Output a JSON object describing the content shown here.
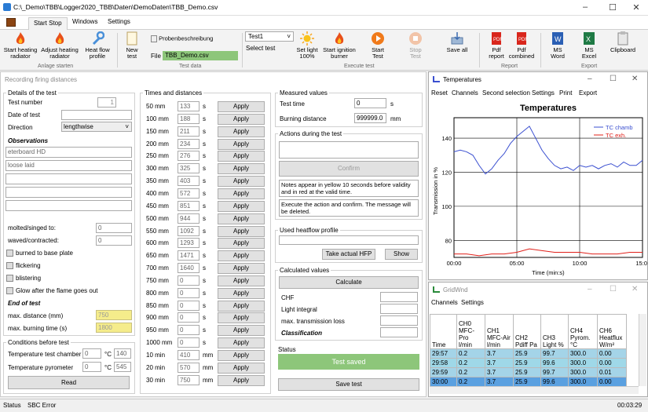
{
  "title": "C:\\_Demo\\TBB\\Logger2020_TBB\\Daten\\DemoDaten\\TBB_Demo.csv",
  "tabs": [
    "Start Stop",
    "Windows",
    "Settings"
  ],
  "ribbon": {
    "start_heating": "Start heating radiator",
    "adjust_heating": "Adjust heating radiator",
    "heat_flow": "Heat flow profile",
    "group_anlage": "Anlage starten",
    "new_test": "New test",
    "probenbeschreibung": "Probenbeschreibung",
    "file_label": "File",
    "file_value": "TBB_Demo.csv",
    "group_testdata": "Test data",
    "test_select": "Test1",
    "select_test": "Select test",
    "set_light": "Set light 100%",
    "start_ignition": "Start ignition burner",
    "start_test": "Start Test",
    "stop_test": "Stop Test",
    "save_all": "Save all",
    "group_execute": "Execute test",
    "pdf_report": "Pdf report",
    "pdf_combined": "Pdf combined",
    "group_report": "Report",
    "ms_word": "MS Word",
    "ms_excel": "MS Excel",
    "clipboard": "Clipboard",
    "group_export": "Export"
  },
  "main": {
    "header": "Recording firing distances",
    "details_title": "Details of the test",
    "test_number_label": "Test number",
    "test_number": "1",
    "date_label": "Date of test",
    "direction_label": "Direction",
    "direction": "lengthwise",
    "observations_label": "Observations",
    "obs": [
      "eterboard HD",
      "loose laid",
      "",
      "",
      "",
      ""
    ],
    "molted_label": "molted/singed to:",
    "molted": "0",
    "waved_label": "waved/contracted:",
    "waved": "0",
    "checks": [
      "burned to base plate",
      "flickering",
      "blistering",
      "Glow after the flame goes out"
    ],
    "end_label": "End of test",
    "max_dist_label": "max. distance (mm)",
    "max_dist": "750",
    "max_time_label": "max. burning time (s)",
    "max_time": "1800",
    "conditions_title": "Conditions before test",
    "temp_chamber_label": "Temperature test chamber",
    "temp_chamber_a": "0",
    "temp_chamber_b": "140",
    "temp_pyro_label": "Temperature pyrometer",
    "temp_pyro_a": "0",
    "temp_pyro_b": "545",
    "unit_c": "°C",
    "read": "Read",
    "times_title": "Times and distances",
    "apply": "Apply",
    "dist_rows": [
      [
        "50 mm",
        "133",
        "s"
      ],
      [
        "100 mm",
        "188",
        "s"
      ],
      [
        "150 mm",
        "211",
        "s"
      ],
      [
        "200 mm",
        "234",
        "s"
      ],
      [
        "250 mm",
        "276",
        "s"
      ],
      [
        "300 mm",
        "325",
        "s"
      ],
      [
        "350 mm",
        "403",
        "s"
      ],
      [
        "400 mm",
        "572",
        "s"
      ],
      [
        "450 mm",
        "851",
        "s"
      ],
      [
        "500 mm",
        "944",
        "s"
      ],
      [
        "550 mm",
        "1092",
        "s"
      ],
      [
        "600 mm",
        "1293",
        "s"
      ],
      [
        "650 mm",
        "1471",
        "s"
      ],
      [
        "700 mm",
        "1640",
        "s"
      ],
      [
        "750 mm",
        "0",
        "s"
      ],
      [
        "800 mm",
        "0",
        "s"
      ],
      [
        "850 mm",
        "0",
        "s"
      ],
      [
        "900 mm",
        "0",
        "s"
      ],
      [
        "950 mm",
        "0",
        "s"
      ],
      [
        "1000 mm",
        "0",
        "s"
      ],
      [
        "10 min",
        "410",
        "mm"
      ],
      [
        "20 min",
        "570",
        "mm"
      ],
      [
        "30 min",
        "750",
        "mm"
      ]
    ],
    "measured_title": "Measured values",
    "test_time_label": "Test time",
    "test_time": "0",
    "unit_s": "s",
    "burning_label": "Burning distance",
    "burning": "999999.0",
    "unit_mm": "mm",
    "actions_title": "Actions during the test",
    "confirm": "Confirm",
    "note1": "Notes appear in yellow 10 seconds before validity and in red at the valid time.",
    "note2": "Execute the action and confirm. The message will be deleted.",
    "heatflow_title": "Used heatflow profile",
    "take_hfp": "Take actual HFP",
    "show": "Show",
    "calc_title": "Calculated values",
    "calculate": "Calculate",
    "chf": "CHF",
    "light_integral": "Light integral",
    "max_trans": "max. transmission loss",
    "classification": "Classification",
    "status_title": "Status",
    "test_saved": "Test saved",
    "save_test": "Save test"
  },
  "temps": {
    "title": "Temperatures",
    "menu": [
      "Reset",
      "Channels",
      "Second selection",
      "Settings",
      "Print",
      "Export"
    ]
  },
  "chart_data": {
    "type": "line",
    "title": "Temperatures",
    "xlabel": "Time (min:s)",
    "ylabel": "Transmission in %",
    "xticks": [
      "00:00",
      "05:00",
      "10:00",
      "15:0"
    ],
    "yticks": [
      "80",
      "100",
      "120",
      "140"
    ],
    "xlim": [
      0,
      900
    ],
    "ylim": [
      70,
      152
    ],
    "legend": "top-right",
    "series": [
      {
        "name": "TC chamb",
        "color": "#3a4fd0",
        "x": [
          0,
          30,
          60,
          90,
          120,
          150,
          180,
          210,
          240,
          270,
          300,
          330,
          360,
          390,
          420,
          450,
          480,
          510,
          540,
          570,
          600,
          630,
          660,
          690,
          720,
          750,
          780,
          810,
          840,
          870,
          900
        ],
        "values": [
          132,
          133,
          132,
          130,
          124,
          119,
          122,
          127,
          131,
          137,
          141,
          144,
          147,
          140,
          133,
          128,
          124,
          122,
          123,
          121,
          124,
          123,
          124,
          122,
          124,
          125,
          123,
          126,
          124,
          124,
          127
        ]
      },
      {
        "name": "TC exh.",
        "color": "#e0201a",
        "x": [
          0,
          60,
          120,
          180,
          240,
          300,
          360,
          420,
          480,
          540,
          600,
          660,
          720,
          780,
          840,
          900
        ],
        "values": [
          72,
          72,
          71,
          72,
          72,
          73,
          75,
          74,
          73,
          73,
          73,
          72,
          72,
          72,
          73,
          73
        ]
      }
    ]
  },
  "gridwnd": {
    "title": "GridWnd",
    "menu": [
      "Channels",
      "Settings"
    ],
    "headers": [
      [
        "Time",
        ""
      ],
      [
        "CH0",
        "MFC-Pro l/min"
      ],
      [
        "CH1",
        "MFC-Air l/min"
      ],
      [
        "CH2",
        "Pdiff Pa"
      ],
      [
        "CH3",
        "Light %"
      ],
      [
        "CH4",
        "Pyrom. °C"
      ],
      [
        "CH6",
        "Heatflux W/m²"
      ]
    ],
    "rows": [
      [
        "29:57",
        "0.2",
        "3.7",
        "25.9",
        "99.7",
        "300.0",
        "0.00"
      ],
      [
        "29:58",
        "0.2",
        "3.7",
        "25.9",
        "99.6",
        "300.0",
        "0.00"
      ],
      [
        "29:59",
        "0.2",
        "3.7",
        "25.9",
        "99.7",
        "300.0",
        "0.01"
      ],
      [
        "30:00",
        "0.2",
        "3.7",
        "25.9",
        "99.6",
        "300.0",
        "0.00"
      ]
    ]
  },
  "status": {
    "status": "Status",
    "sbc": "SBC Error",
    "time": "00:03:29"
  }
}
